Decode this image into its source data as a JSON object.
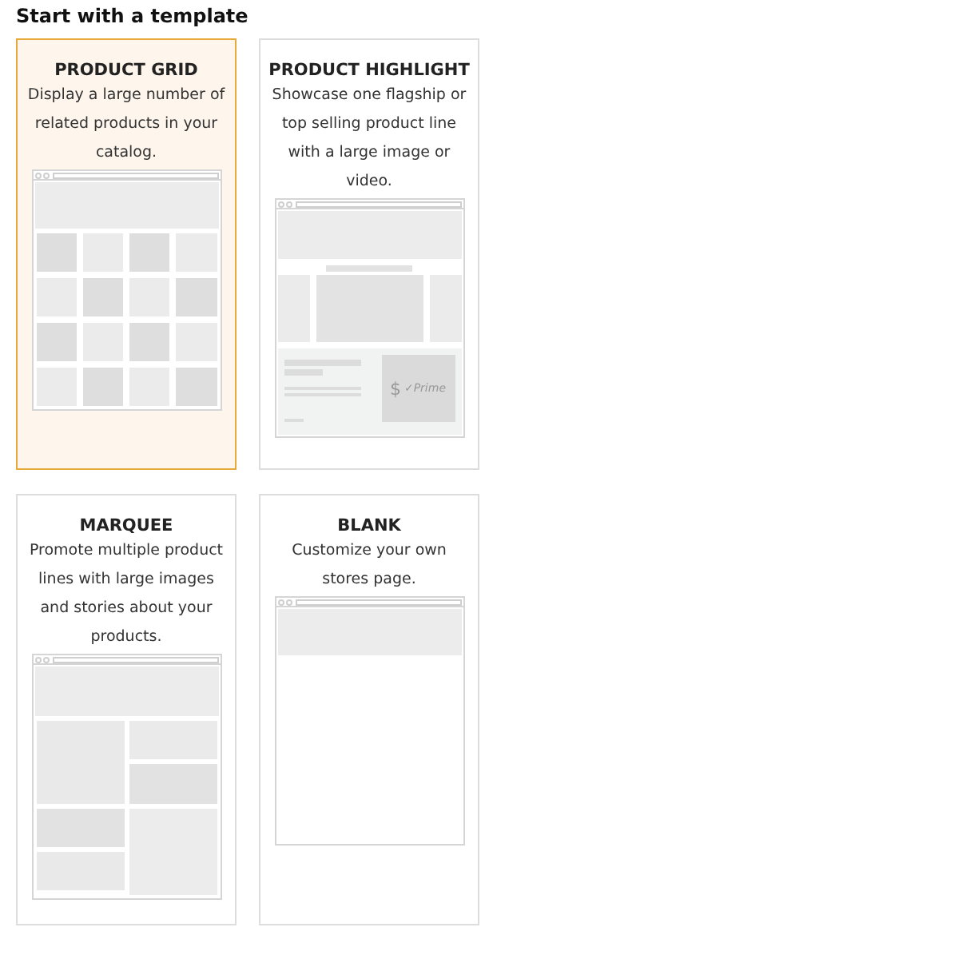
{
  "heading": "Start with a template",
  "templates": [
    {
      "kind": "grid",
      "title": "PRODUCT GRID",
      "description": "Display a large number of related products in your catalog.",
      "selected": true
    },
    {
      "kind": "highlight",
      "title": "PRODUCT HIGHLIGHT",
      "description": "Showcase one flagship or top selling product line with a large image or video.",
      "selected": false,
      "price_symbol": "$",
      "badge": "✓Prime"
    },
    {
      "kind": "marquee",
      "title": "MARQUEE",
      "description": "Promote multiple product lines with large images and stories about your products.",
      "selected": false
    },
    {
      "kind": "blank",
      "title": "BLANK",
      "description": "Customize your own stores page.",
      "selected": false
    }
  ]
}
